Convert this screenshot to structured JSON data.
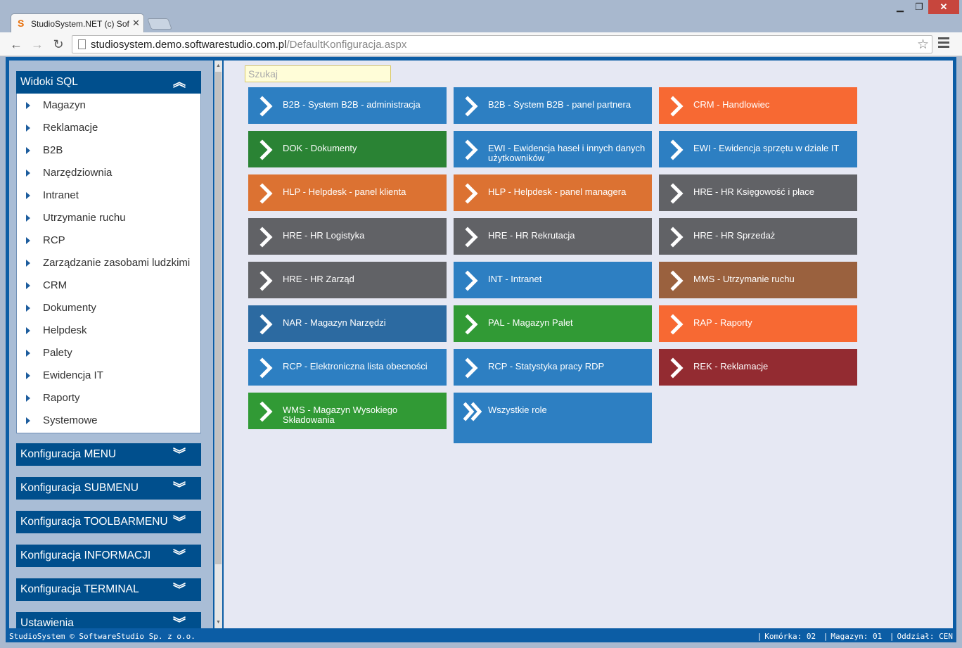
{
  "browser": {
    "tab_title": "StudioSystem.NET (c) Soft",
    "tab_favicon": "S",
    "close_glyph": "✕",
    "url_host": "studiosystem.demo.softwarestudio.com.pl",
    "url_path": "/DefaultKonfiguracja.aspx",
    "back_glyph": "←",
    "forward_glyph": "→",
    "reload_glyph": "↻",
    "star_glyph": "☆",
    "min_glyph": "▁",
    "max_glyph": "❐",
    "winclose_glyph": "✕"
  },
  "sidebar": {
    "sql_panel": {
      "title": "Widoki SQL",
      "chevron": "︽",
      "items": [
        "Magazyn",
        "Reklamacje",
        "B2B",
        "Narzędziownia",
        "Intranet",
        "Utrzymanie ruchu",
        "RCP",
        "Zarządzanie zasobami ludzkimi",
        "CRM",
        "Dokumenty",
        "Helpdesk",
        "Palety",
        "Ewidencja IT",
        "Raporty",
        "Systemowe"
      ]
    },
    "collapsed_panels": [
      {
        "title": "Konfiguracja MENU",
        "chevron": "︾"
      },
      {
        "title": "Konfiguracja SUBMENU",
        "chevron": "︾"
      },
      {
        "title": "Konfiguracja TOOLBARMENU",
        "chevron": "︾"
      },
      {
        "title": "Konfiguracja INFORMACJI",
        "chevron": "︾"
      },
      {
        "title": "Konfiguracja TERMINAL",
        "chevron": "︾"
      },
      {
        "title": "Ustawienia",
        "chevron": "︾"
      }
    ]
  },
  "main": {
    "search_placeholder": "Szukaj",
    "tiles": [
      {
        "label": "B2B - System B2B - administracja",
        "color": "#2d7fc2",
        "icon": "chevron-right-icon"
      },
      {
        "label": "B2B - System B2B - panel partnera",
        "color": "#2d7fc2",
        "icon": "chevron-right-icon"
      },
      {
        "label": "CRM - Handlowiec",
        "color": "#f76933",
        "icon": "chevron-right-icon"
      },
      {
        "label": "DOK - Dokumenty",
        "color": "#2a8334",
        "icon": "chevron-right-icon"
      },
      {
        "label": "EWI - Ewidencja haseł i innych danych użytkowników",
        "color": "#2d7fc2",
        "icon": "chevron-right-icon"
      },
      {
        "label": "EWI - Ewidencja sprzętu w dziale IT",
        "color": "#2d7fc2",
        "icon": "chevron-right-icon"
      },
      {
        "label": "HLP - Helpdesk - panel klienta",
        "color": "#dc7232",
        "icon": "chevron-right-icon"
      },
      {
        "label": "HLP - Helpdesk - panel managera",
        "color": "#dc7232",
        "icon": "chevron-right-icon"
      },
      {
        "label": "HRE - HR Księgowość i płace",
        "color": "#616266",
        "icon": "chevron-right-icon"
      },
      {
        "label": "HRE - HR Logistyka",
        "color": "#616266",
        "icon": "chevron-right-icon"
      },
      {
        "label": "HRE - HR Rekrutacja",
        "color": "#616266",
        "icon": "chevron-right-icon"
      },
      {
        "label": "HRE - HR Sprzedaż",
        "color": "#616266",
        "icon": "chevron-right-icon"
      },
      {
        "label": "HRE - HR Zarząd",
        "color": "#616266",
        "icon": "chevron-right-icon"
      },
      {
        "label": "INT - Intranet",
        "color": "#2d7fc2",
        "icon": "chevron-right-icon"
      },
      {
        "label": "MMS - Utrzymanie ruchu",
        "color": "#9a613e",
        "icon": "chevron-right-icon"
      },
      {
        "label": "NAR - Magazyn Narzędzi",
        "color": "#2c6aa1",
        "icon": "chevron-right-icon"
      },
      {
        "label": "PAL - Magazyn Palet",
        "color": "#319a35",
        "icon": "chevron-right-icon"
      },
      {
        "label": "RAP - Raporty",
        "color": "#f76933",
        "icon": "chevron-right-icon"
      },
      {
        "label": "RCP - Elektroniczna lista obecności",
        "color": "#2d7fc2",
        "icon": "chevron-right-icon"
      },
      {
        "label": "RCP - Statystyka pracy RDP",
        "color": "#2d7fc2",
        "icon": "chevron-right-icon"
      },
      {
        "label": "REK - Reklamacje",
        "color": "#932b31",
        "icon": "chevron-right-icon"
      },
      {
        "label": "WMS - Magazyn Wysokiego Składowania",
        "color": "#319a35",
        "icon": "chevron-right-icon"
      },
      {
        "label": "Wszystkie role",
        "color": "#2d7fc2",
        "icon": "double-chevron-right-icon"
      }
    ]
  },
  "statusbar": {
    "left": "StudioSystem © SoftwareStudio Sp. z o.o.",
    "komorka": "Komórka: 02",
    "magazyn": "Magazyn: 01",
    "oddzial": "Oddział: CEN",
    "sep": "|"
  }
}
